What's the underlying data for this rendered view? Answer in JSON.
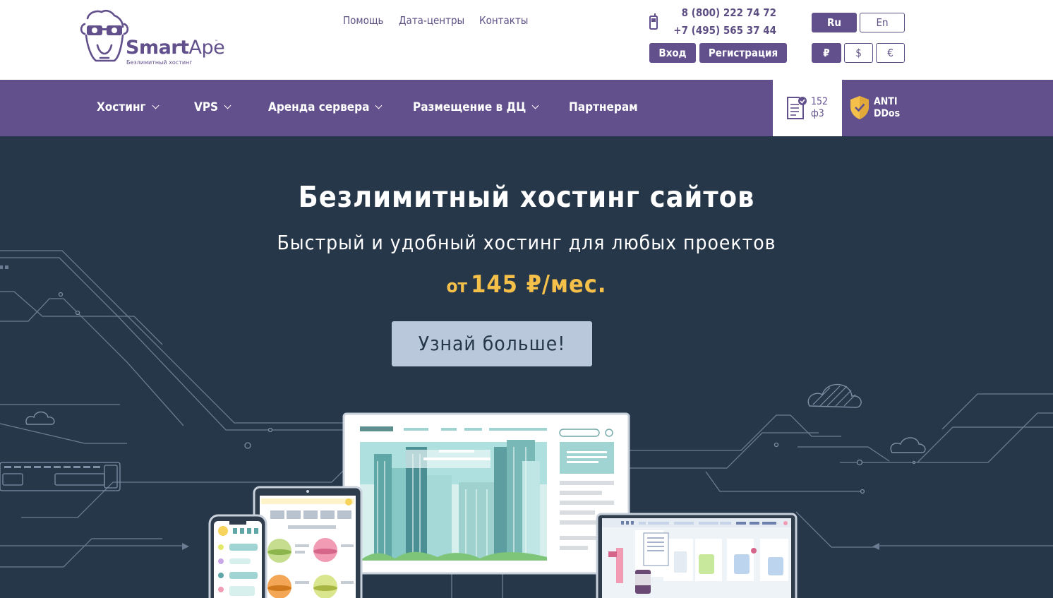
{
  "brand": {
    "name_bold": "Smart",
    "name_light": "Ape",
    "tm": "™",
    "tagline": "Безлимитный хостинг"
  },
  "top_links": [
    "Помощь",
    "Дата-центры",
    "Контакты"
  ],
  "phones": [
    "8 (800) 222 74 72",
    "+7 (495) 565 37 44"
  ],
  "auth": {
    "login": "Вход",
    "register": "Регистрация"
  },
  "languages": {
    "ru": "Ru",
    "en": "En"
  },
  "currencies": {
    "rub": "₽",
    "usd": "$",
    "eur": "€"
  },
  "nav": [
    {
      "label": "Хостинг"
    },
    {
      "label": "VPS"
    },
    {
      "label": "Аренда сервера"
    },
    {
      "label": "Размещение в ДЦ"
    },
    {
      "label": "Партнерам"
    }
  ],
  "badges": {
    "fz_line1": "152",
    "fz_line2": "ф3",
    "ddos_line1": "ANTI",
    "ddos_line2": "DDos"
  },
  "hero": {
    "title": "Безлимитный хостинг сайтов",
    "subtitle": "Быстрый и удобный хостинг для любых проектов",
    "price_from": "от",
    "price": "145 ₽/мес.",
    "cta": "Узнай больше!"
  },
  "colors": {
    "brand_purple": "#62508c",
    "hero_bg": "#27374a",
    "price_yellow": "#f4c04a",
    "cta_bg": "#b9c8da"
  }
}
